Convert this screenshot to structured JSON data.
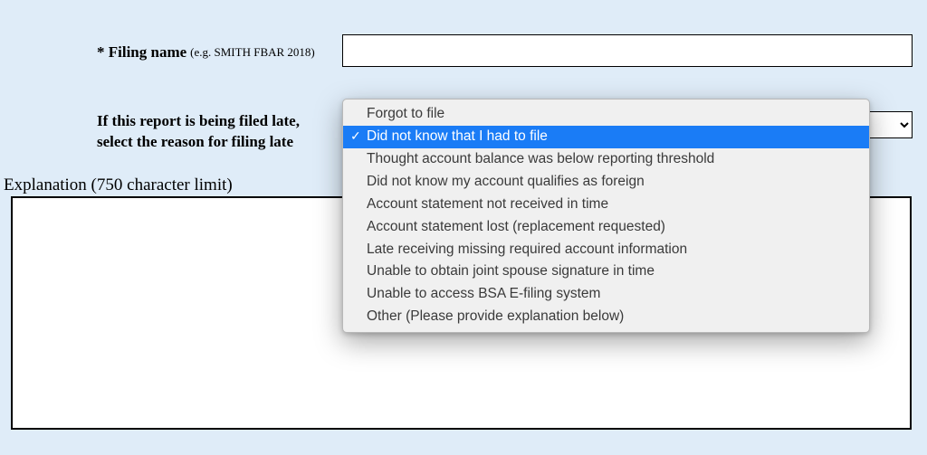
{
  "filing": {
    "label_prefix": "* Filing name",
    "label_hint": "(e.g. SMITH FBAR 2018)",
    "value": ""
  },
  "late_reason": {
    "label": "If this report is being filed late, select the reason for filing late",
    "selected_index": 1,
    "options": [
      "Forgot to file",
      "Did not know that I had to file",
      "Thought account balance was below reporting threshold",
      "Did not know my account qualifies as foreign",
      "Account statement not received in time",
      "Account statement lost (replacement requested)",
      "Late receiving missing required account information",
      "Unable to obtain joint spouse signature in time",
      "Unable to access BSA E-filing system",
      "Other (Please provide explanation below)"
    ]
  },
  "explanation": {
    "label": "Explanation (750 character limit)",
    "value": ""
  }
}
